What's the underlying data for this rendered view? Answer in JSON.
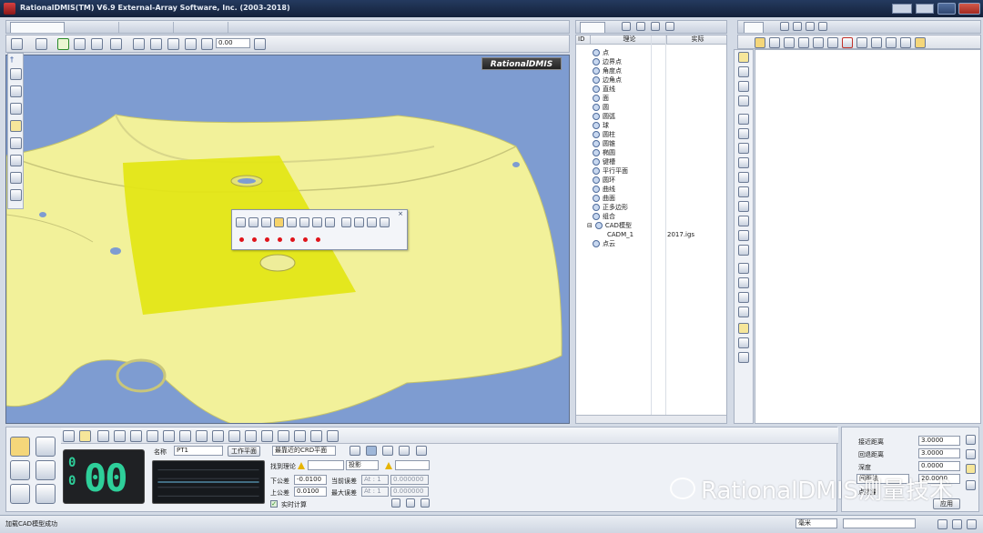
{
  "window": {
    "title": "RationalDMIS(TM) V6.9    External-Array Software, Inc. (2003-2018)"
  },
  "cad_toolbar": {
    "zoom_value": "0.00"
  },
  "viewport": {
    "brand": "RationalDMIS"
  },
  "tree": {
    "columns": {
      "id": "ID",
      "nominal": "理论",
      "actual": "实际"
    },
    "items": [
      {
        "label": "点"
      },
      {
        "label": "边界点"
      },
      {
        "label": "角度点"
      },
      {
        "label": "边角点"
      },
      {
        "label": "直线"
      },
      {
        "label": "面"
      },
      {
        "label": "圆"
      },
      {
        "label": "圆弧"
      },
      {
        "label": "球"
      },
      {
        "label": "圆柱"
      },
      {
        "label": "圆锥"
      },
      {
        "label": "椭圆"
      },
      {
        "label": "键槽"
      },
      {
        "label": "平行平面"
      },
      {
        "label": "圆环"
      },
      {
        "label": "曲线"
      },
      {
        "label": "曲面"
      },
      {
        "label": "正多边形"
      },
      {
        "label": "组合"
      },
      {
        "label": "CAD模型"
      },
      {
        "label": "CADM_1",
        "actual": "2017.igs"
      },
      {
        "label": "点云"
      }
    ]
  },
  "bottom": {
    "counter": {
      "big": "00",
      "small_top": "0",
      "small_bottom": "0"
    },
    "name_label": "名称",
    "name_value": "PT1",
    "workplane_button": "工作平面",
    "workplane_select": "最靠近的CRD平面",
    "find_nominal_label": "找到理论",
    "projection_select": "投影",
    "lower_tol_label": "下公差",
    "lower_tol_value": "-0.0100",
    "upper_tol_label": "上公差",
    "upper_tol_value": "0.0100",
    "cur_err_label": "当前误差",
    "cur_err_axis": "At : 1",
    "cur_err_value": "0.000000",
    "max_err_label": "最大误差",
    "max_err_axis": "At : 1",
    "max_err_value": "0.000000",
    "realtime_label": "实时计算"
  },
  "params": {
    "approach_label": "接近距离",
    "approach_value": "3.0000",
    "retract_label": "回退距离",
    "retract_value": "3.0000",
    "depth_label": "深度",
    "depth_value": "0.0000",
    "mode_select": "间距法",
    "mode_value": "20.0000",
    "count_label": "点数量",
    "apply_button": "应用"
  },
  "status": {
    "message": "加载CAD模型成功",
    "units": "毫米"
  },
  "watermark": "RationalDMIS测量技术",
  "colors": {
    "title_bg": "#1b2a48",
    "viewport_bg": "#7e9cd1",
    "part_yellow": "#f2f19a",
    "selection_yellow": "#e3e617",
    "counter_green": "#2ecf9a",
    "point_red": "#e0141b"
  }
}
